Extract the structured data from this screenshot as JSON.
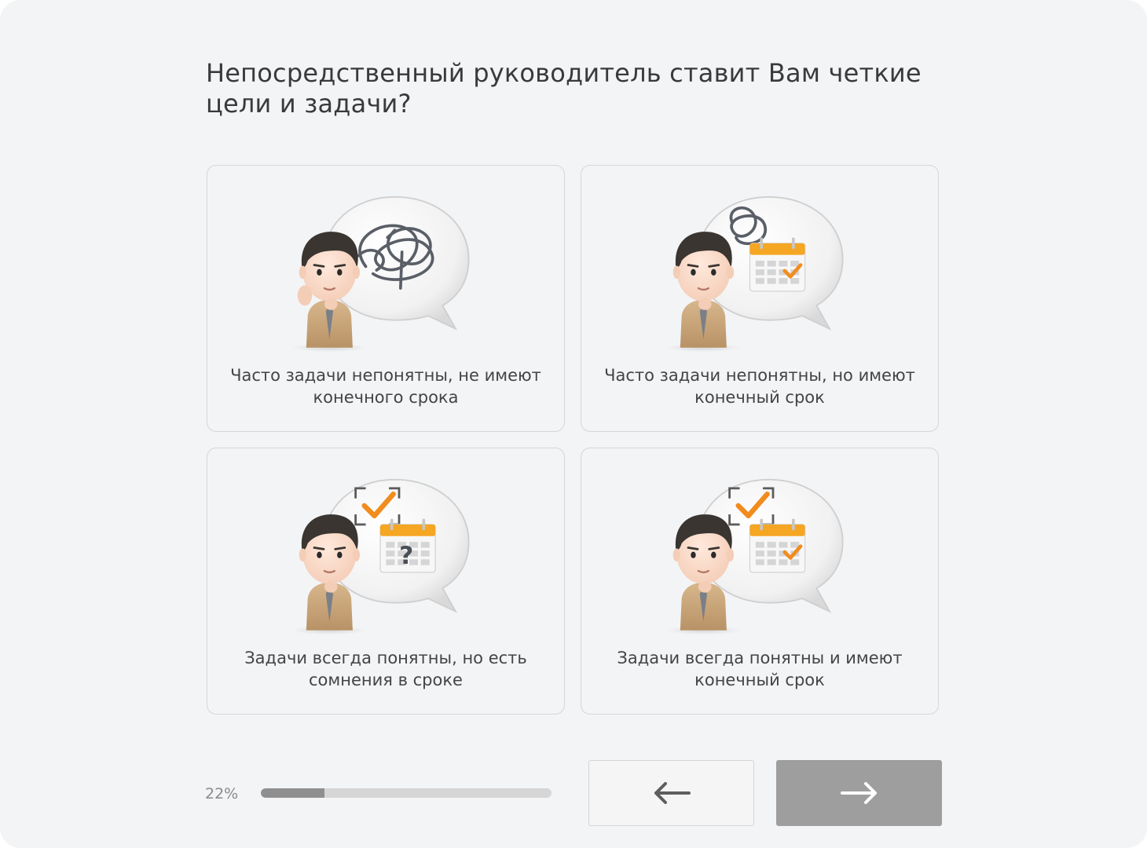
{
  "question": {
    "title": "Непосредственный руководитель ставит Вам четкие цели и задачи?"
  },
  "options": [
    {
      "label": "Часто задачи непонятны, не имеют конечного срока",
      "icon": "confused-person-scribble-icon"
    },
    {
      "label": "Часто задачи непонятны, но имеют конечный срок",
      "icon": "thinking-person-calendar-icon"
    },
    {
      "label": "Задачи всегда понятны, но есть сомнения в сроке",
      "icon": "person-question-calendar-icon"
    },
    {
      "label": "Задачи всегда понятны и имеют конечный срок",
      "icon": "smiling-person-checked-calendar-icon"
    }
  ],
  "progress": {
    "label": "22%",
    "value": 0.22
  },
  "navigation": {
    "back_icon": "arrow-left-icon",
    "next_icon": "arrow-right-icon"
  },
  "colors": {
    "accent": "#f28c1e",
    "background": "#f3f4f6",
    "next_button": "#9e9e9e"
  }
}
